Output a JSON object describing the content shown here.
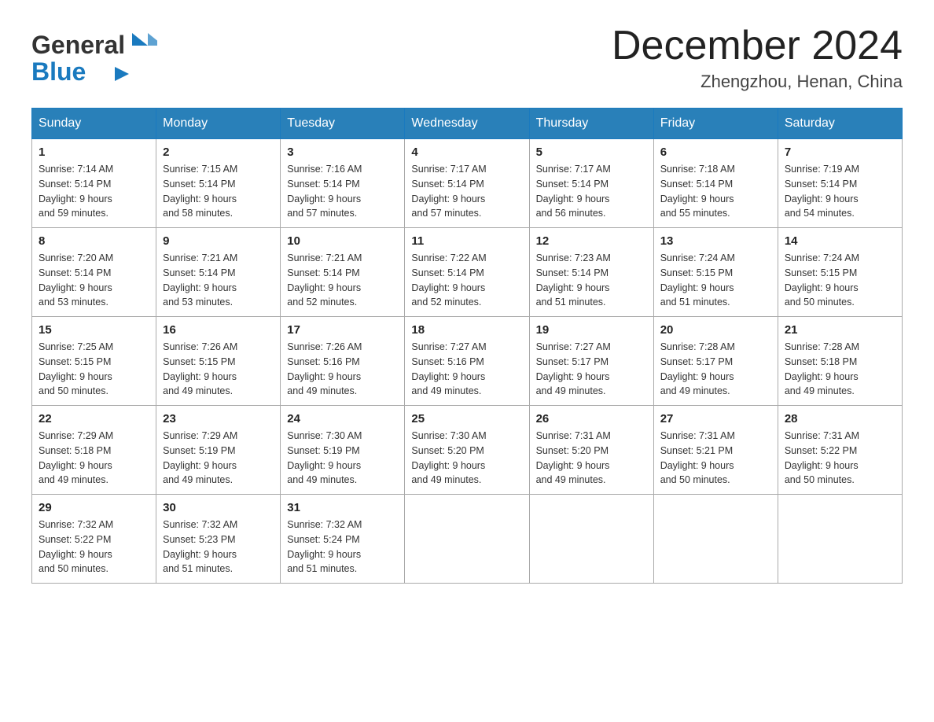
{
  "header": {
    "logo_general": "General",
    "logo_blue": "Blue",
    "month_title": "December 2024",
    "location": "Zhengzhou, Henan, China"
  },
  "days_of_week": [
    "Sunday",
    "Monday",
    "Tuesday",
    "Wednesday",
    "Thursday",
    "Friday",
    "Saturday"
  ],
  "weeks": [
    [
      {
        "day": "1",
        "sunrise": "7:14 AM",
        "sunset": "5:14 PM",
        "daylight": "9 hours and 59 minutes."
      },
      {
        "day": "2",
        "sunrise": "7:15 AM",
        "sunset": "5:14 PM",
        "daylight": "9 hours and 58 minutes."
      },
      {
        "day": "3",
        "sunrise": "7:16 AM",
        "sunset": "5:14 PM",
        "daylight": "9 hours and 57 minutes."
      },
      {
        "day": "4",
        "sunrise": "7:17 AM",
        "sunset": "5:14 PM",
        "daylight": "9 hours and 57 minutes."
      },
      {
        "day": "5",
        "sunrise": "7:17 AM",
        "sunset": "5:14 PM",
        "daylight": "9 hours and 56 minutes."
      },
      {
        "day": "6",
        "sunrise": "7:18 AM",
        "sunset": "5:14 PM",
        "daylight": "9 hours and 55 minutes."
      },
      {
        "day": "7",
        "sunrise": "7:19 AM",
        "sunset": "5:14 PM",
        "daylight": "9 hours and 54 minutes."
      }
    ],
    [
      {
        "day": "8",
        "sunrise": "7:20 AM",
        "sunset": "5:14 PM",
        "daylight": "9 hours and 53 minutes."
      },
      {
        "day": "9",
        "sunrise": "7:21 AM",
        "sunset": "5:14 PM",
        "daylight": "9 hours and 53 minutes."
      },
      {
        "day": "10",
        "sunrise": "7:21 AM",
        "sunset": "5:14 PM",
        "daylight": "9 hours and 52 minutes."
      },
      {
        "day": "11",
        "sunrise": "7:22 AM",
        "sunset": "5:14 PM",
        "daylight": "9 hours and 52 minutes."
      },
      {
        "day": "12",
        "sunrise": "7:23 AM",
        "sunset": "5:14 PM",
        "daylight": "9 hours and 51 minutes."
      },
      {
        "day": "13",
        "sunrise": "7:24 AM",
        "sunset": "5:15 PM",
        "daylight": "9 hours and 51 minutes."
      },
      {
        "day": "14",
        "sunrise": "7:24 AM",
        "sunset": "5:15 PM",
        "daylight": "9 hours and 50 minutes."
      }
    ],
    [
      {
        "day": "15",
        "sunrise": "7:25 AM",
        "sunset": "5:15 PM",
        "daylight": "9 hours and 50 minutes."
      },
      {
        "day": "16",
        "sunrise": "7:26 AM",
        "sunset": "5:15 PM",
        "daylight": "9 hours and 49 minutes."
      },
      {
        "day": "17",
        "sunrise": "7:26 AM",
        "sunset": "5:16 PM",
        "daylight": "9 hours and 49 minutes."
      },
      {
        "day": "18",
        "sunrise": "7:27 AM",
        "sunset": "5:16 PM",
        "daylight": "9 hours and 49 minutes."
      },
      {
        "day": "19",
        "sunrise": "7:27 AM",
        "sunset": "5:17 PM",
        "daylight": "9 hours and 49 minutes."
      },
      {
        "day": "20",
        "sunrise": "7:28 AM",
        "sunset": "5:17 PM",
        "daylight": "9 hours and 49 minutes."
      },
      {
        "day": "21",
        "sunrise": "7:28 AM",
        "sunset": "5:18 PM",
        "daylight": "9 hours and 49 minutes."
      }
    ],
    [
      {
        "day": "22",
        "sunrise": "7:29 AM",
        "sunset": "5:18 PM",
        "daylight": "9 hours and 49 minutes."
      },
      {
        "day": "23",
        "sunrise": "7:29 AM",
        "sunset": "5:19 PM",
        "daylight": "9 hours and 49 minutes."
      },
      {
        "day": "24",
        "sunrise": "7:30 AM",
        "sunset": "5:19 PM",
        "daylight": "9 hours and 49 minutes."
      },
      {
        "day": "25",
        "sunrise": "7:30 AM",
        "sunset": "5:20 PM",
        "daylight": "9 hours and 49 minutes."
      },
      {
        "day": "26",
        "sunrise": "7:31 AM",
        "sunset": "5:20 PM",
        "daylight": "9 hours and 49 minutes."
      },
      {
        "day": "27",
        "sunrise": "7:31 AM",
        "sunset": "5:21 PM",
        "daylight": "9 hours and 50 minutes."
      },
      {
        "day": "28",
        "sunrise": "7:31 AM",
        "sunset": "5:22 PM",
        "daylight": "9 hours and 50 minutes."
      }
    ],
    [
      {
        "day": "29",
        "sunrise": "7:32 AM",
        "sunset": "5:22 PM",
        "daylight": "9 hours and 50 minutes."
      },
      {
        "day": "30",
        "sunrise": "7:32 AM",
        "sunset": "5:23 PM",
        "daylight": "9 hours and 51 minutes."
      },
      {
        "day": "31",
        "sunrise": "7:32 AM",
        "sunset": "5:24 PM",
        "daylight": "9 hours and 51 minutes."
      },
      null,
      null,
      null,
      null
    ]
  ],
  "labels": {
    "sunrise": "Sunrise:",
    "sunset": "Sunset:",
    "daylight": "Daylight:"
  }
}
